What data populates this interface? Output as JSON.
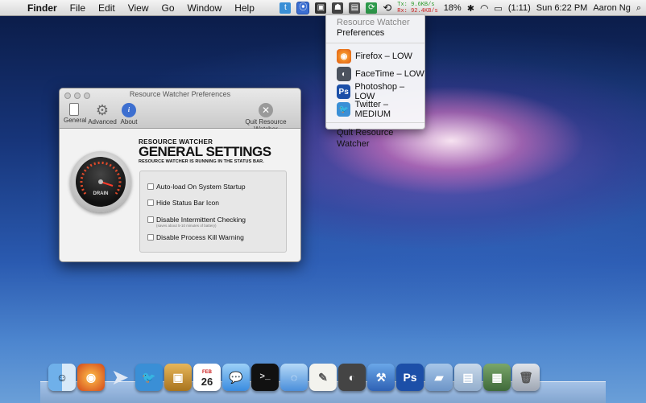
{
  "menubar": {
    "app_name": "Finder",
    "items": [
      "File",
      "Edit",
      "View",
      "Go",
      "Window",
      "Help"
    ],
    "net_tx": "Tx: 9.6KB/s",
    "net_rx": "Rx: 92.4KB/s",
    "battery_percent": "18%",
    "battery_time": "(1:11)",
    "clock": "Sun 6:22 PM",
    "user": "Aaron Ng"
  },
  "dropdown": {
    "header": "Resource Watcher",
    "preferences": "Preferences",
    "apps": [
      {
        "label": "Firefox – LOW",
        "icon": "firefox-icon",
        "color": "#e66b1c"
      },
      {
        "label": "FaceTime – LOW",
        "icon": "facetime-icon",
        "color": "#555b66"
      },
      {
        "label": "Photoshop – LOW",
        "icon": "photoshop-icon",
        "color": "#1c4fa8",
        "glyph": "Ps"
      },
      {
        "label": "Twitter – MEDIUM",
        "icon": "twitter-icon",
        "color": "#3a8fd6"
      }
    ],
    "quit": "Quit Resource Watcher"
  },
  "window": {
    "title": "Resource Watcher Preferences",
    "toolbar": {
      "general": "General",
      "advanced": "Advanced",
      "about": "About",
      "quit": "Quit Resource Watcher"
    },
    "heading_small": "RESOURCE WATCHER",
    "heading_big": "GENERAL SETTINGS",
    "heading_note": "RESOURCE WATCHER IS RUNNING IN THE STATUS BAR.",
    "gauge_label": "DRAIN",
    "options": [
      {
        "label": "Auto-load On System Startup"
      },
      {
        "label": "Hide Status Bar Icon"
      },
      {
        "label": "Disable Intermittent Checking",
        "sub": "(saves about 5-10 minutes of battery)"
      },
      {
        "label": "Disable Process Kill Warning"
      }
    ]
  },
  "dock": {
    "calendar_day": "26",
    "calendar_month": "FEB"
  }
}
